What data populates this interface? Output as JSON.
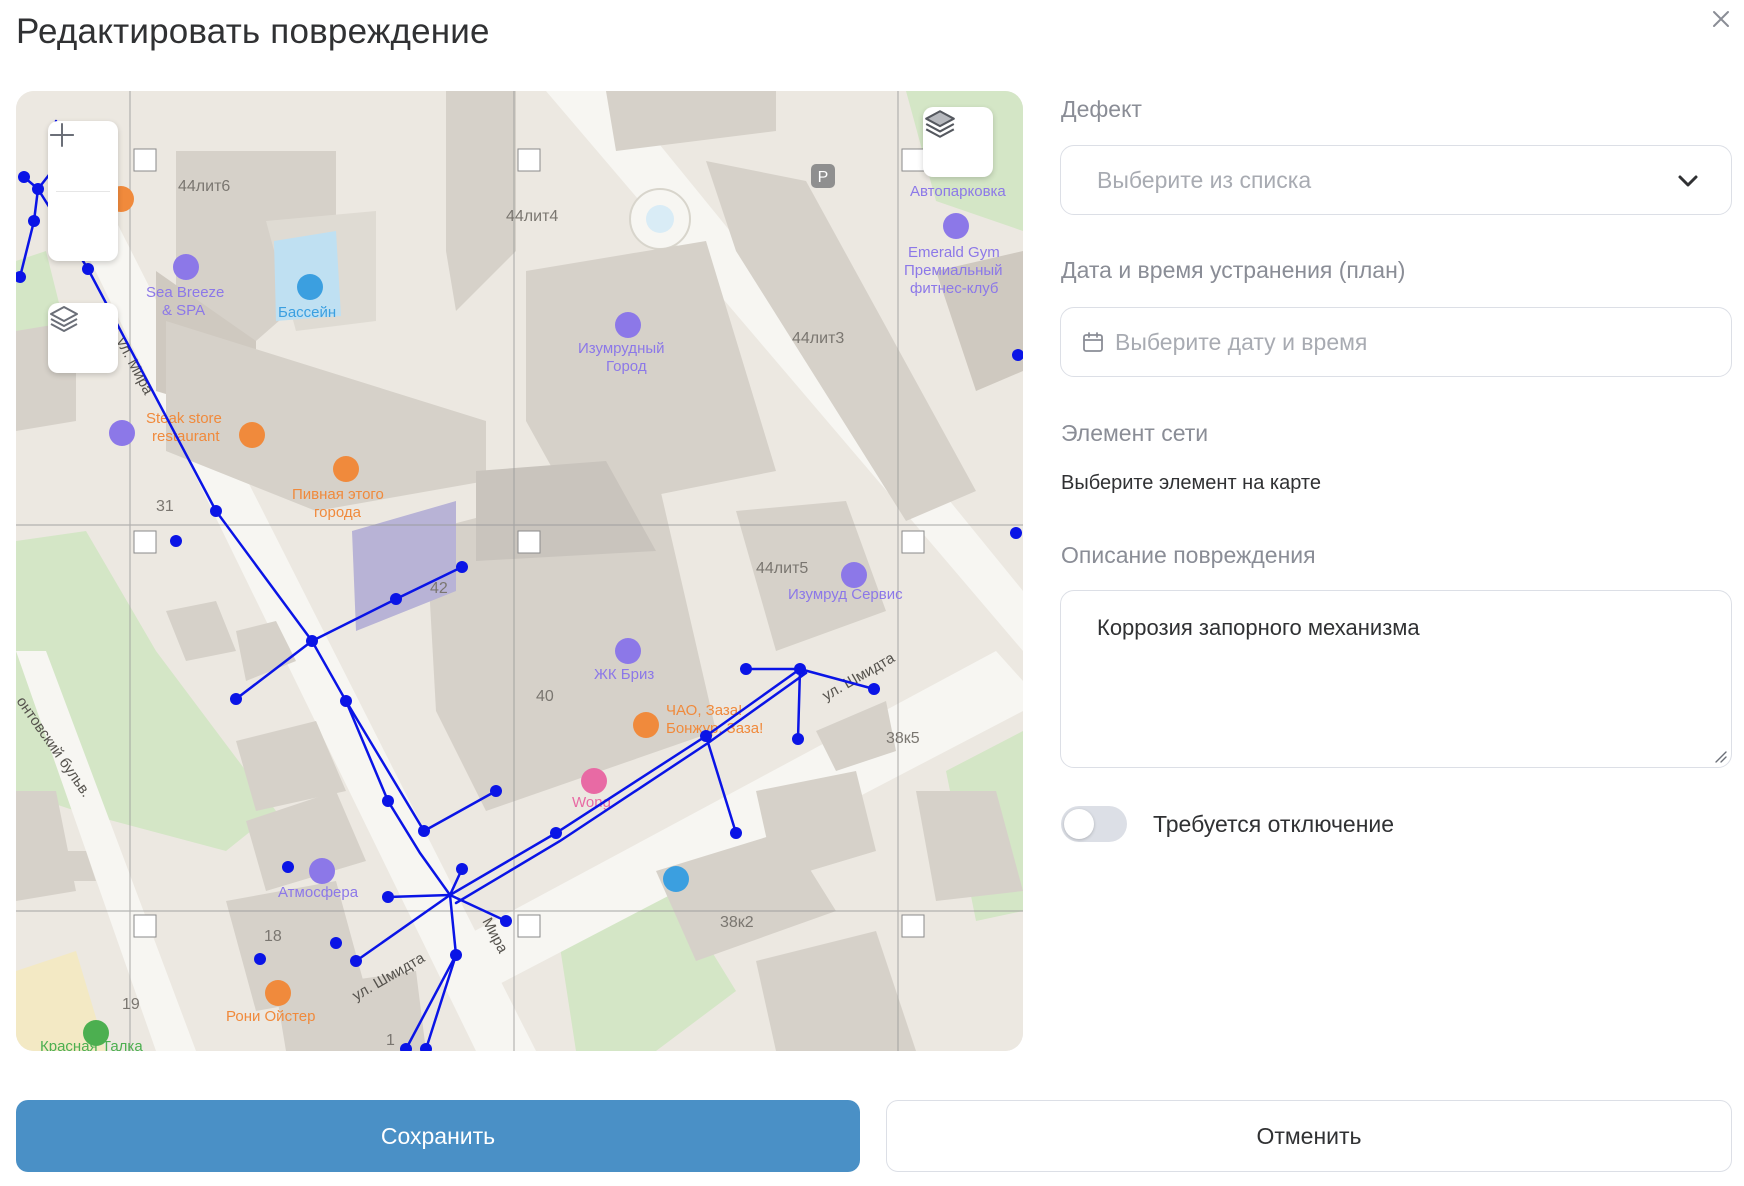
{
  "modal": {
    "title": "Редактировать повреждение"
  },
  "form": {
    "defect": {
      "label": "Дефект",
      "placeholder": "Выберите из списка"
    },
    "fix_date": {
      "label": "Дата и время устранения (план)",
      "placeholder": "Выберите дату и время"
    },
    "network_element": {
      "label": "Элемент сети",
      "hint": "Выберите элемент на карте"
    },
    "description": {
      "label": "Описание повреждения",
      "value": "Коррозия запорного механизма"
    },
    "shutdown": {
      "label": "Требуется отключение",
      "enabled": false
    }
  },
  "actions": {
    "save": "Сохранить",
    "cancel": "Отменить"
  },
  "map": {
    "labels": {
      "b44l6": "44лит6",
      "b44l4": "44лит4",
      "b44l3": "44лит3",
      "b44l5": "44лит5",
      "b31": "31",
      "b42": "42",
      "b40": "40",
      "b38k5": "38к5",
      "b38k2": "38к2",
      "b18": "18",
      "b19": "19",
      "b1": "1",
      "parking": "Автопарковка",
      "emerald1": "Emerald Gym",
      "emerald2": "Премиальный",
      "emerald3": "фитнес-клуб",
      "seabreeze1": "Sea Breeze",
      "seabreeze2": "& SPA",
      "pool": "Бассейн",
      "izumrud1": "Изумрудный",
      "izumrud2": "Город",
      "steak1": "Steak store",
      "steak2": "restaurant",
      "pivnaya1": "Пивная этого",
      "pivnaya2": "города",
      "izservice": "Изумруд Сервис",
      "briz": "ЖК Бриз",
      "chao1": "ЧАО, Заза!",
      "chao2": "Бонжур, Заза!",
      "wong": "Wong",
      "atmosfera": "Атмосфера",
      "roni": "Рони Ойстер",
      "krasnaya": "Красная Талка",
      "street_mira_top": "ул. Мира",
      "street_mira_bot": "Мира",
      "street_schmidt1": "ул. Шмидта",
      "street_schmidt2": "ул. Шмидта",
      "bulvar": "онтовский бульв."
    }
  }
}
